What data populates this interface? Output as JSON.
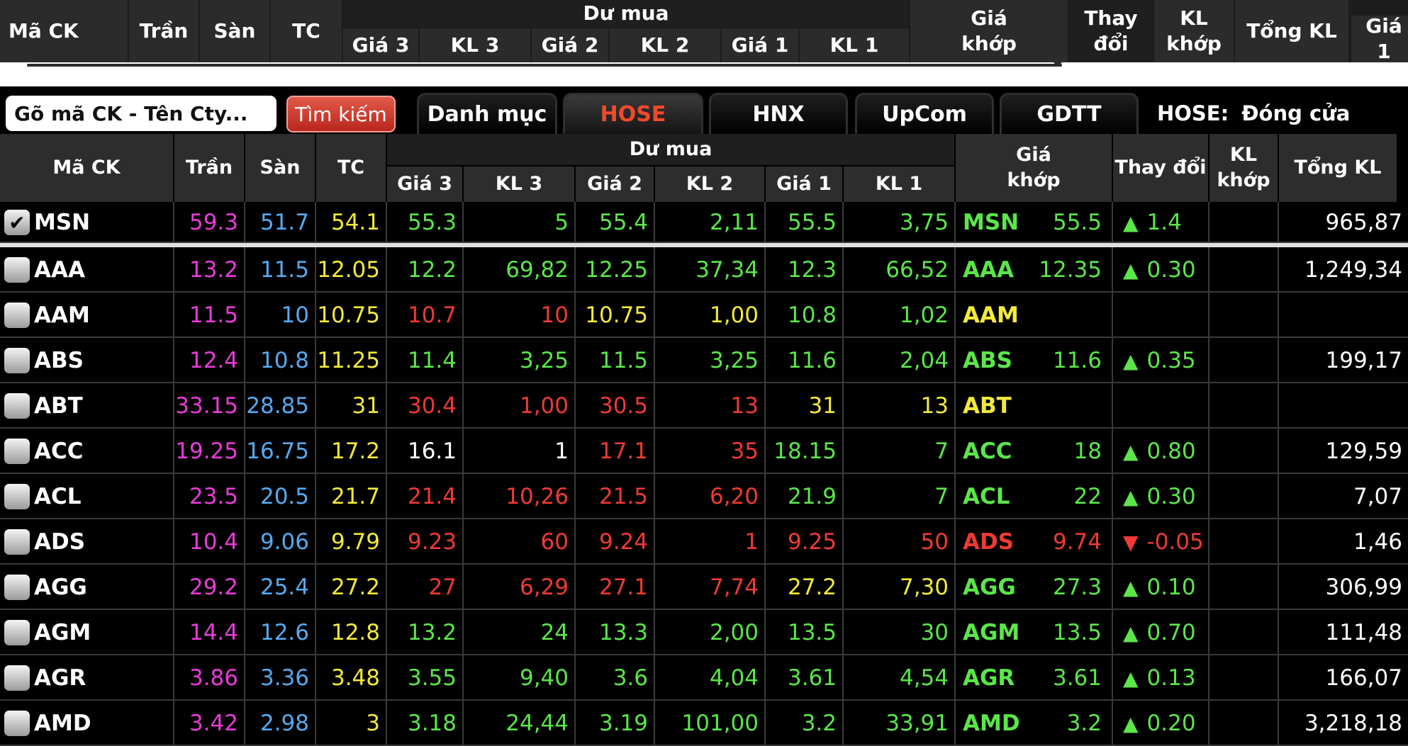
{
  "top_header": {
    "ma_ck": "Mã CK",
    "tran": "Trần",
    "san": "Sàn",
    "tc": "TC",
    "du_mua": "Dư mua",
    "gia3": "Giá 3",
    "kl3": "KL 3",
    "gia2": "Giá 2",
    "kl2": "KL 2",
    "gia1": "Giá 1",
    "kl1": "KL 1",
    "gia_khop": "Giá\nkhớp",
    "thay_doi": "Thay đổi",
    "kl_khop": "KL\nkhớp",
    "tong_kl": "Tổng KL",
    "cut_label": "Giá 1"
  },
  "search": {
    "placeholder": "Gõ mã CK - Tên Cty...",
    "button_label": "Tìm kiếm"
  },
  "market_tabs": [
    "Danh mục",
    "HOSE",
    "HNX",
    "UpCom",
    "GDTT"
  ],
  "active_tab": "HOSE",
  "market_status": {
    "exchange": "HOSE:",
    "status": "Đóng cửa"
  },
  "table_header": {
    "ma_ck": "Mã CK",
    "tran": "Trần",
    "san": "Sàn",
    "tc": "TC",
    "du_mua": "Dư mua",
    "gia3": "Giá 3",
    "kl3": "KL 3",
    "gia2": "Giá 2",
    "kl2": "KL 2",
    "gia1": "Giá 1",
    "kl1": "KL 1",
    "gia_khop": "Giá\nkhớp",
    "thay_doi": "Thay đổi",
    "kl_khop": "KL\nkhớp",
    "tong_kl": "Tổng KL"
  },
  "colors": {
    "ceiling": "#e83bd8",
    "floor": "#55aaf0",
    "reference": "#f2ea3a",
    "up": "#5be64a",
    "down": "#ee3a33",
    "neutral": "#ffffff"
  },
  "rows": [
    {
      "symbol": "MSN",
      "checked": true,
      "tran": "59.3",
      "san": "51.7",
      "tc": "54.1",
      "gia3": {
        "v": "55.3",
        "c": "up"
      },
      "kl3": {
        "v": "5",
        "c": "up"
      },
      "gia2": {
        "v": "55.4",
        "c": "up"
      },
      "kl2": {
        "v": "2,11",
        "c": "up"
      },
      "gia1": {
        "v": "55.5",
        "c": "up"
      },
      "kl1": {
        "v": "3,75",
        "c": "up"
      },
      "match_price": "55.5",
      "match_color": "up",
      "change": "1.4",
      "change_dir": "up",
      "kl_khop": "",
      "tong_kl": "965,87"
    },
    {
      "symbol": "AAA",
      "checked": false,
      "tran": "13.2",
      "san": "11.5",
      "tc": "12.05",
      "gia3": {
        "v": "12.2",
        "c": "up"
      },
      "kl3": {
        "v": "69,82",
        "c": "up"
      },
      "gia2": {
        "v": "12.25",
        "c": "up"
      },
      "kl2": {
        "v": "37,34",
        "c": "up"
      },
      "gia1": {
        "v": "12.3",
        "c": "up"
      },
      "kl1": {
        "v": "66,52",
        "c": "up"
      },
      "match_price": "12.35",
      "match_color": "up",
      "change": "0.30",
      "change_dir": "up",
      "kl_khop": "",
      "tong_kl": "1,249,34"
    },
    {
      "symbol": "AAM",
      "checked": false,
      "tran": "11.5",
      "san": "10",
      "tc": "10.75",
      "gia3": {
        "v": "10.7",
        "c": "down"
      },
      "kl3": {
        "v": "10",
        "c": "down"
      },
      "gia2": {
        "v": "10.75",
        "c": "reference"
      },
      "kl2": {
        "v": "1,00",
        "c": "reference"
      },
      "gia1": {
        "v": "10.8",
        "c": "up"
      },
      "kl1": {
        "v": "1,02",
        "c": "up"
      },
      "match_price": "",
      "match_color": "reference",
      "change": "",
      "change_dir": "none",
      "kl_khop": "",
      "tong_kl": ""
    },
    {
      "symbol": "ABS",
      "checked": false,
      "tran": "12.4",
      "san": "10.8",
      "tc": "11.25",
      "gia3": {
        "v": "11.4",
        "c": "up"
      },
      "kl3": {
        "v": "3,25",
        "c": "up"
      },
      "gia2": {
        "v": "11.5",
        "c": "up"
      },
      "kl2": {
        "v": "3,25",
        "c": "up"
      },
      "gia1": {
        "v": "11.6",
        "c": "up"
      },
      "kl1": {
        "v": "2,04",
        "c": "up"
      },
      "match_price": "11.6",
      "match_color": "up",
      "change": "0.35",
      "change_dir": "up",
      "kl_khop": "",
      "tong_kl": "199,17"
    },
    {
      "symbol": "ABT",
      "checked": false,
      "tran": "33.15",
      "san": "28.85",
      "tc": "31",
      "gia3": {
        "v": "30.4",
        "c": "down"
      },
      "kl3": {
        "v": "1,00",
        "c": "down"
      },
      "gia2": {
        "v": "30.5",
        "c": "down"
      },
      "kl2": {
        "v": "13",
        "c": "down"
      },
      "gia1": {
        "v": "31",
        "c": "reference"
      },
      "kl1": {
        "v": "13",
        "c": "reference"
      },
      "match_price": "",
      "match_color": "reference",
      "change": "",
      "change_dir": "none",
      "kl_khop": "",
      "tong_kl": ""
    },
    {
      "symbol": "ACC",
      "checked": false,
      "tran": "19.25",
      "san": "16.75",
      "tc": "17.2",
      "gia3": {
        "v": "16.1",
        "c": "neutral"
      },
      "kl3": {
        "v": "1",
        "c": "neutral"
      },
      "gia2": {
        "v": "17.1",
        "c": "down"
      },
      "kl2": {
        "v": "35",
        "c": "down"
      },
      "gia1": {
        "v": "18.15",
        "c": "up"
      },
      "kl1": {
        "v": "7",
        "c": "up"
      },
      "match_price": "18",
      "match_color": "up",
      "change": "0.80",
      "change_dir": "up",
      "kl_khop": "",
      "tong_kl": "129,59"
    },
    {
      "symbol": "ACL",
      "checked": false,
      "tran": "23.5",
      "san": "20.5",
      "tc": "21.7",
      "gia3": {
        "v": "21.4",
        "c": "down"
      },
      "kl3": {
        "v": "10,26",
        "c": "down"
      },
      "gia2": {
        "v": "21.5",
        "c": "down"
      },
      "kl2": {
        "v": "6,20",
        "c": "down"
      },
      "gia1": {
        "v": "21.9",
        "c": "up"
      },
      "kl1": {
        "v": "7",
        "c": "up"
      },
      "match_price": "22",
      "match_color": "up",
      "change": "0.30",
      "change_dir": "up",
      "kl_khop": "",
      "tong_kl": "7,07"
    },
    {
      "symbol": "ADS",
      "checked": false,
      "tran": "10.4",
      "san": "9.06",
      "tc": "9.79",
      "gia3": {
        "v": "9.23",
        "c": "down"
      },
      "kl3": {
        "v": "60",
        "c": "down"
      },
      "gia2": {
        "v": "9.24",
        "c": "down"
      },
      "kl2": {
        "v": "1",
        "c": "down"
      },
      "gia1": {
        "v": "9.25",
        "c": "down"
      },
      "kl1": {
        "v": "50",
        "c": "down"
      },
      "match_price": "9.74",
      "match_color": "down",
      "change": "-0.05",
      "change_dir": "down",
      "kl_khop": "",
      "tong_kl": "1,46"
    },
    {
      "symbol": "AGG",
      "checked": false,
      "tran": "29.2",
      "san": "25.4",
      "tc": "27.2",
      "gia3": {
        "v": "27",
        "c": "down"
      },
      "kl3": {
        "v": "6,29",
        "c": "down"
      },
      "gia2": {
        "v": "27.1",
        "c": "down"
      },
      "kl2": {
        "v": "7,74",
        "c": "down"
      },
      "gia1": {
        "v": "27.2",
        "c": "reference"
      },
      "kl1": {
        "v": "7,30",
        "c": "reference"
      },
      "match_price": "27.3",
      "match_color": "up",
      "change": "0.10",
      "change_dir": "up",
      "kl_khop": "",
      "tong_kl": "306,99"
    },
    {
      "symbol": "AGM",
      "checked": false,
      "tran": "14.4",
      "san": "12.6",
      "tc": "12.8",
      "gia3": {
        "v": "13.2",
        "c": "up"
      },
      "kl3": {
        "v": "24",
        "c": "up"
      },
      "gia2": {
        "v": "13.3",
        "c": "up"
      },
      "kl2": {
        "v": "2,00",
        "c": "up"
      },
      "gia1": {
        "v": "13.5",
        "c": "up"
      },
      "kl1": {
        "v": "30",
        "c": "up"
      },
      "match_price": "13.5",
      "match_color": "up",
      "change": "0.70",
      "change_dir": "up",
      "kl_khop": "",
      "tong_kl": "111,48"
    },
    {
      "symbol": "AGR",
      "checked": false,
      "tran": "3.86",
      "san": "3.36",
      "tc": "3.48",
      "gia3": {
        "v": "3.55",
        "c": "up"
      },
      "kl3": {
        "v": "9,40",
        "c": "up"
      },
      "gia2": {
        "v": "3.6",
        "c": "up"
      },
      "kl2": {
        "v": "4,04",
        "c": "up"
      },
      "gia1": {
        "v": "3.61",
        "c": "up"
      },
      "kl1": {
        "v": "4,54",
        "c": "up"
      },
      "match_price": "3.61",
      "match_color": "up",
      "change": "0.13",
      "change_dir": "up",
      "kl_khop": "",
      "tong_kl": "166,07"
    },
    {
      "symbol": "AMD",
      "checked": false,
      "tran": "3.42",
      "san": "2.98",
      "tc": "3",
      "gia3": {
        "v": "3.18",
        "c": "up"
      },
      "kl3": {
        "v": "24,44",
        "c": "up"
      },
      "gia2": {
        "v": "3.19",
        "c": "up"
      },
      "kl2": {
        "v": "101,00",
        "c": "up"
      },
      "gia1": {
        "v": "3.2",
        "c": "up"
      },
      "kl1": {
        "v": "33,91",
        "c": "up"
      },
      "match_price": "3.2",
      "match_color": "up",
      "change": "0.20",
      "change_dir": "up",
      "kl_khop": "",
      "tong_kl": "3,218,18"
    }
  ]
}
